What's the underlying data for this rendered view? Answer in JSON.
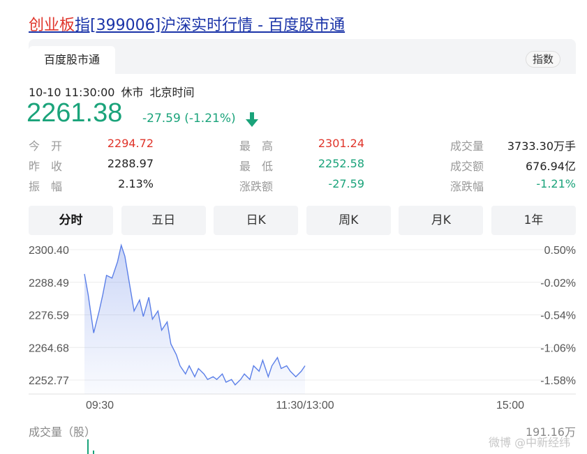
{
  "title": {
    "highlight": "创业板",
    "rest": "指[399006]沪深实时行情 - 百度股市通"
  },
  "tabbar": {
    "tab": "百度股市通",
    "pill": "指数"
  },
  "status": {
    "datetime": "10-10 11:30:00",
    "state": "休市",
    "timezone": "北京时间"
  },
  "quote": {
    "price": "2261.38",
    "change": "-27.59 (-1.21%)"
  },
  "stats": {
    "open_label": "今　开",
    "open": "2294.72",
    "prev_label": "昨　收",
    "prev": "2288.97",
    "amp_label": "振　幅",
    "amp": "2.13%",
    "high_label": "最　高",
    "high": "2301.24",
    "low_label": "最　低",
    "low": "2252.58",
    "chg_label": "涨跌额",
    "chg": "-27.59",
    "vol_label": "成交量",
    "vol": "3733.30万手",
    "amt_label": "成交额",
    "amt": "676.94亿",
    "pct_label": "涨跌幅",
    "pct": "-1.21%"
  },
  "ranges": [
    "分时",
    "五日",
    "日K",
    "周K",
    "月K",
    "1年"
  ],
  "active_range": 0,
  "chart_data": {
    "type": "area",
    "y_left_labels": [
      "2300.40",
      "2288.49",
      "2276.59",
      "2264.68",
      "2252.77"
    ],
    "y_right_labels": [
      "0.50%",
      "-0.02%",
      "-0.54%",
      "-1.06%",
      "-1.58%"
    ],
    "x_labels": [
      "09:30",
      "11:30/13:00",
      "15:00"
    ],
    "ylim": [
      2252.77,
      2300.4
    ],
    "line_color": "#5b7fe8",
    "series": [
      {
        "x": [
          "09:30",
          "09:32",
          "09:35",
          "09:38",
          "09:40",
          "09:42",
          "09:45",
          "09:48",
          "09:50",
          "09:52",
          "09:55",
          "09:57",
          "10:00",
          "10:02",
          "10:05",
          "10:07",
          "10:10",
          "10:12",
          "10:15",
          "10:17",
          "10:20",
          "10:22",
          "10:25",
          "10:27",
          "10:30",
          "10:32",
          "10:35",
          "10:37",
          "10:40",
          "10:42",
          "10:45",
          "10:47",
          "10:50",
          "10:52",
          "10:55",
          "10:57",
          "11:00",
          "11:02",
          "11:05",
          "11:07",
          "11:10",
          "11:12",
          "11:15",
          "11:17",
          "11:20",
          "11:22",
          "11:25",
          "11:28",
          "11:30"
        ],
        "values": [
          2291.5,
          2284,
          2270,
          2278,
          2284,
          2291,
          2290,
          2296,
          2302,
          2298,
          2286,
          2278,
          2282,
          2276,
          2283,
          2275,
          2278,
          2271,
          2274,
          2266,
          2262,
          2258,
          2255,
          2258,
          2254,
          2257,
          2255,
          2253,
          2254,
          2253,
          2255,
          2252,
          2253,
          2251,
          2253,
          2255,
          2253,
          2258,
          2256,
          2260,
          2254,
          2258,
          2261,
          2257,
          2258,
          2256,
          2254,
          2256,
          2258
        ]
      }
    ]
  },
  "volume": {
    "label": "成交量（股）",
    "max": "191.16万"
  },
  "watermark": "微博 @中新经纬"
}
